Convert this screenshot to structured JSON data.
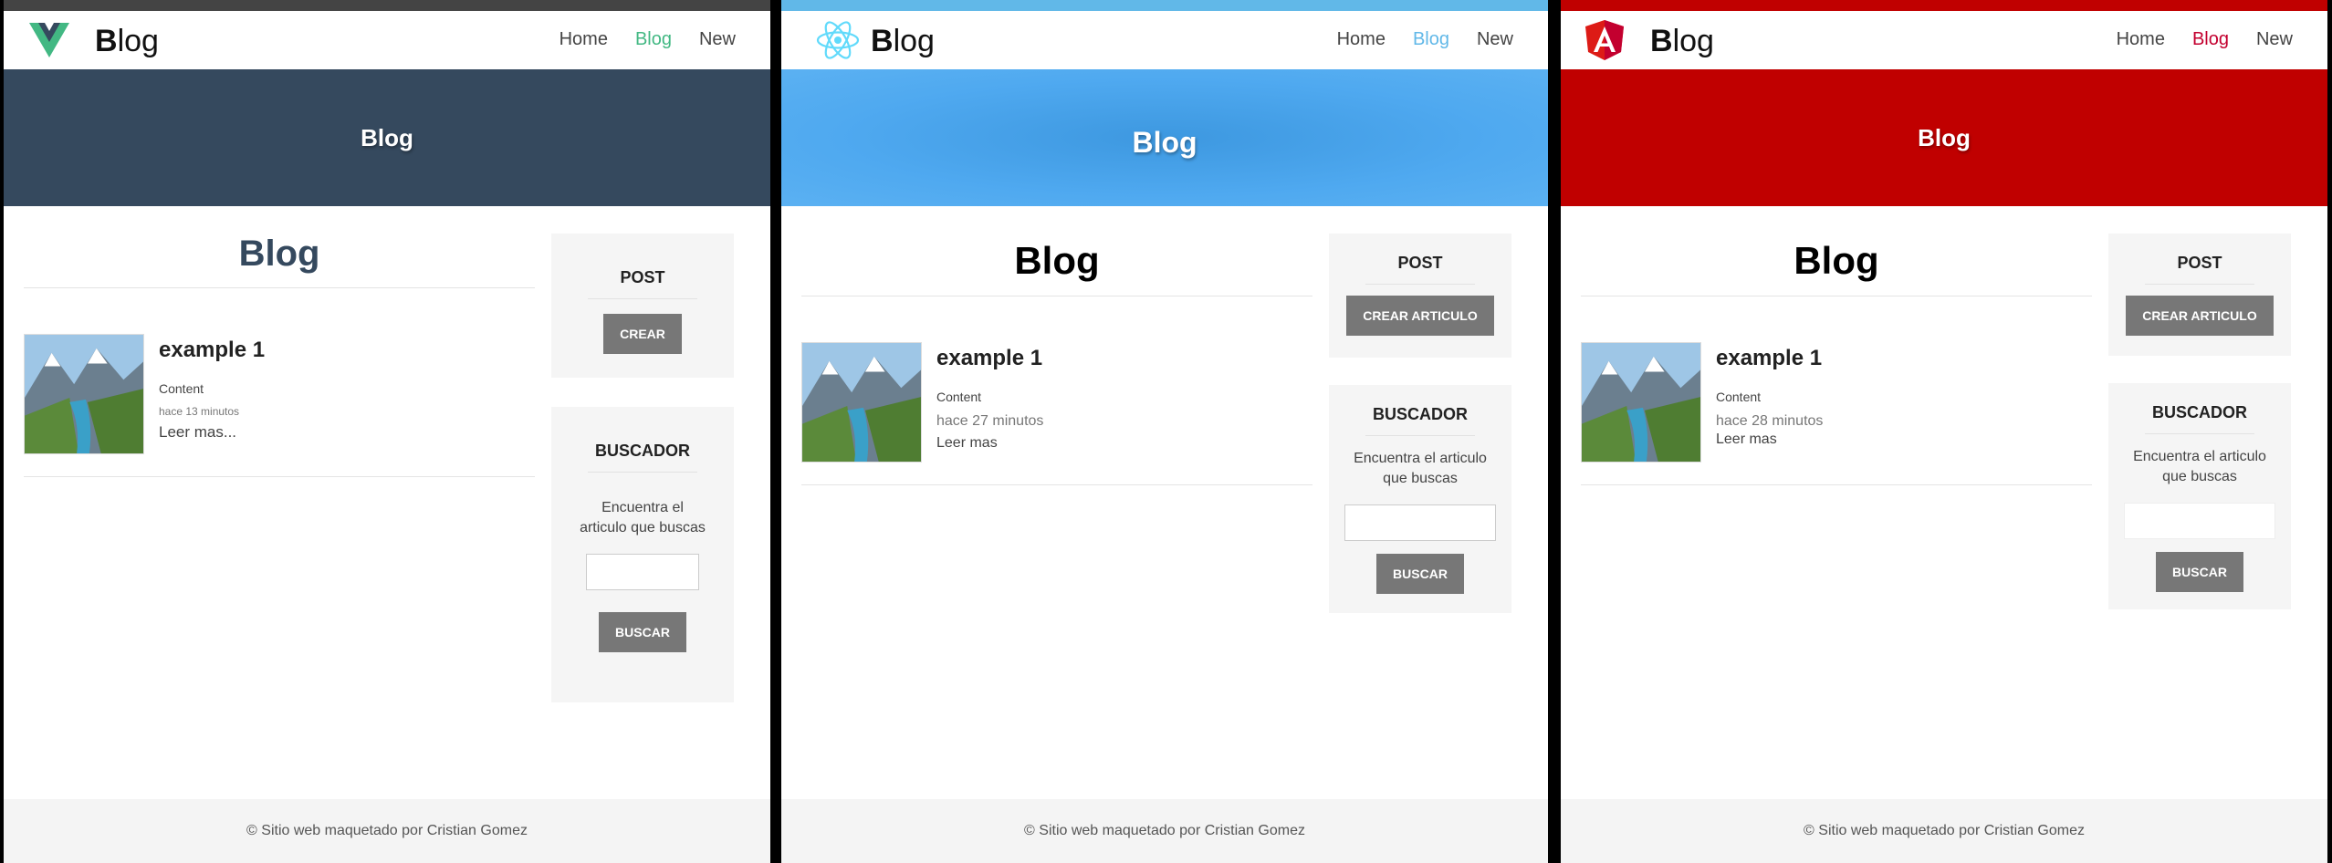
{
  "panels": {
    "vue": {
      "brand": "Blog",
      "nav": [
        "Home",
        "Blog",
        "New"
      ],
      "hero_title": "Blog",
      "main_title": "Blog",
      "article": {
        "title": "example 1",
        "content": "Content",
        "time": "hace 13 minutos",
        "more": "Leer mas..."
      },
      "post_widget": {
        "title": "POST",
        "button": "CREAR"
      },
      "search_widget": {
        "title": "BUSCADOR",
        "text": "Encuentra el articulo que buscas",
        "button": "BUSCAR"
      },
      "footer": "© Sitio web maquetado por Cristian Gomez",
      "colors": {
        "hero": "#35495e",
        "accent": "#42b883",
        "title": "#35495e"
      }
    },
    "react": {
      "brand": "Blog",
      "nav": [
        "Home",
        "Blog",
        "New"
      ],
      "hero_title": "Blog",
      "main_title": "Blog",
      "article": {
        "title": "example 1",
        "content": "Content",
        "time": "hace 27 minutos",
        "more": "Leer mas"
      },
      "post_widget": {
        "title": "POST",
        "button": "CREAR ARTICULO"
      },
      "search_widget": {
        "title": "BUSCADOR",
        "text": "Encuentra el articulo que buscas",
        "button": "BUSCAR"
      },
      "footer": "© Sitio web maquetado por Cristian Gomez",
      "colors": {
        "hero": "#4fa9f0",
        "accent": "#61b8e8",
        "title": "#000000"
      }
    },
    "angular": {
      "brand": "Blog",
      "nav": [
        "Home",
        "Blog",
        "New"
      ],
      "hero_title": "Blog",
      "main_title": "Blog",
      "article": {
        "title": "example 1",
        "content": "Content",
        "time": "hace 28 minutos",
        "more": "Leer mas"
      },
      "post_widget": {
        "title": "POST",
        "button": "CREAR ARTICULO"
      },
      "search_widget": {
        "title": "BUSCADOR",
        "text": "Encuentra el articulo que buscas",
        "button": "BUSCAR"
      },
      "footer": "© Sitio web maquetado por Cristian Gomez",
      "colors": {
        "hero": "#c00000",
        "accent": "#c3002f",
        "title": "#000000"
      }
    }
  },
  "icons": {
    "vue": "vue-logo-icon",
    "react": "react-logo-icon",
    "angular": "angular-logo-icon",
    "thumbnail": "landscape-thumbnail"
  }
}
